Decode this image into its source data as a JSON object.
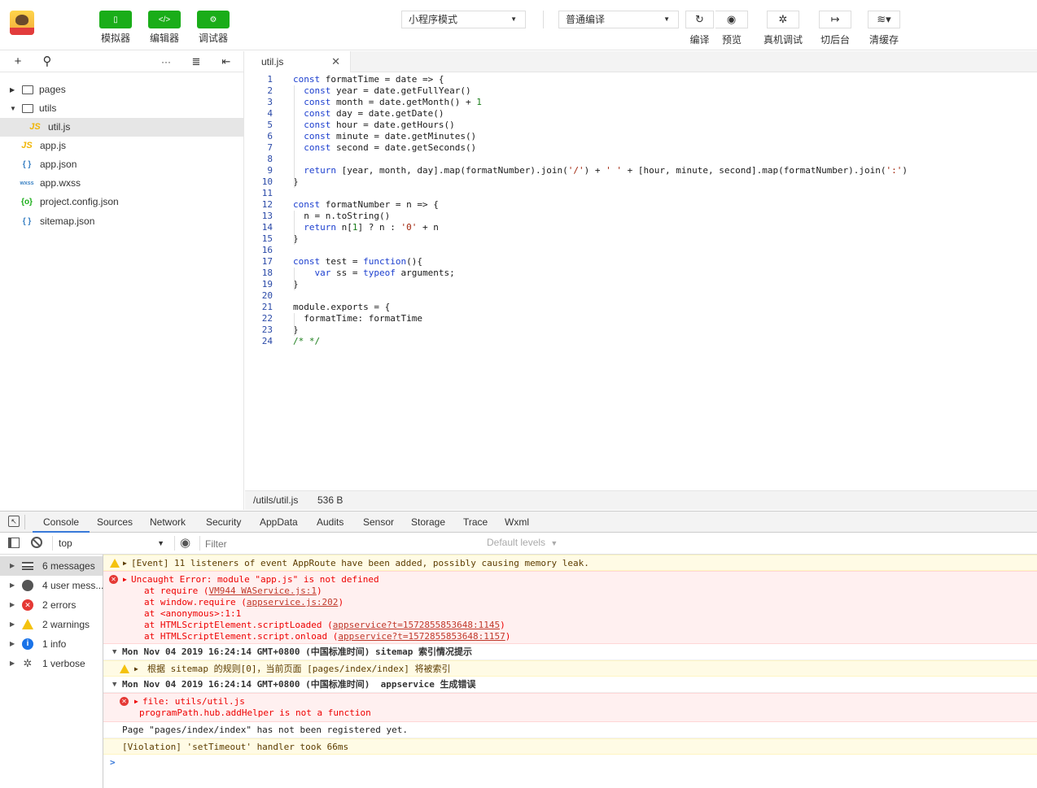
{
  "toolbar": {
    "buttons": [
      {
        "label": "模拟器",
        "icon": "phone-icon",
        "glyph": "▯"
      },
      {
        "label": "编辑器",
        "icon": "code-icon",
        "glyph": "</>"
      },
      {
        "label": "调试器",
        "icon": "debug-icon",
        "glyph": "⚙"
      }
    ],
    "mode_select": "小程序模式",
    "compile_select": "普通编译",
    "actions": [
      {
        "label": "编译",
        "icon": "refresh-icon",
        "glyph": "↻"
      },
      {
        "label": "预览",
        "icon": "eye-icon",
        "glyph": "◉"
      },
      {
        "label": "真机调试",
        "icon": "bug-icon",
        "glyph": "✲"
      },
      {
        "label": "切后台",
        "icon": "switch-background-icon",
        "glyph": "↦"
      },
      {
        "label": "清缓存",
        "icon": "layers-icon",
        "glyph": "≋▾"
      }
    ]
  },
  "explorer": {
    "tools": [
      {
        "name": "add-icon",
        "glyph": "+"
      },
      {
        "name": "search-icon",
        "glyph": "⚲"
      },
      {
        "name": "more-icon",
        "glyph": "···"
      },
      {
        "name": "sort-icon",
        "glyph": "≣"
      },
      {
        "name": "collapse-icon",
        "glyph": "⇤"
      }
    ],
    "tree": [
      {
        "label": "pages",
        "type": "folder",
        "expanded": false,
        "depth": 0,
        "icon_text": "▭"
      },
      {
        "label": "utils",
        "type": "folder",
        "expanded": true,
        "depth": 0,
        "icon_text": "▭"
      },
      {
        "label": "util.js",
        "type": "js",
        "depth": 1,
        "selected": true,
        "icon_text": "JS",
        "icon_color": "#f0b400"
      },
      {
        "label": "app.js",
        "type": "js",
        "depth": 0,
        "icon_text": "JS",
        "icon_color": "#f0b400"
      },
      {
        "label": "app.json",
        "type": "json",
        "depth": 0,
        "icon_text": "{ }",
        "icon_color": "#3b82c4"
      },
      {
        "label": "app.wxss",
        "type": "wxss",
        "depth": 0,
        "icon_text": "wxss",
        "icon_color": "#3b82c4"
      },
      {
        "label": "project.config.json",
        "type": "config",
        "depth": 0,
        "icon_text": "{o}",
        "icon_color": "#1aad19"
      },
      {
        "label": "sitemap.json",
        "type": "json",
        "depth": 0,
        "icon_text": "{ }",
        "icon_color": "#3b82c4"
      }
    ]
  },
  "editor": {
    "tab": "util.js",
    "lines": [
      "const formatTime = date => {",
      "  const year = date.getFullYear()",
      "  const month = date.getMonth() + 1",
      "  const day = date.getDate()",
      "  const hour = date.getHours()",
      "  const minute = date.getMinutes()",
      "  const second = date.getSeconds()",
      "",
      "  return [year, month, day].map(formatNumber).join('/') + ' ' + [hour, minute, second].map(formatNumber).join(':')",
      "}",
      "",
      "const formatNumber = n => {",
      "  n = n.toString()",
      "  return n[1] ? n : '0' + n",
      "}",
      "",
      "const test = function(){",
      "    var ss = typeof arguments;",
      "}",
      "",
      "module.exports = {",
      "  formatTime: formatTime",
      "}",
      "/* */"
    ],
    "status_path": "/utils/util.js",
    "status_size": "536 B"
  },
  "devtools": {
    "inspect_icon": "inspect-icon",
    "tabs": [
      "Console",
      "Sources",
      "Network",
      "Security",
      "AppData",
      "Audits",
      "Sensor",
      "Storage",
      "Trace",
      "Wxml"
    ],
    "active_tab": "Console",
    "context": "top",
    "filter_placeholder": "Filter",
    "levels": "Default levels",
    "sidebar": [
      {
        "label": "6 messages",
        "icon": "list-icon",
        "active": true
      },
      {
        "label": "4 user mess...",
        "icon": "user-icon"
      },
      {
        "label": "2 errors",
        "icon": "error-icon"
      },
      {
        "label": "2 warnings",
        "icon": "warning-icon"
      },
      {
        "label": "1 info",
        "icon": "info-icon"
      },
      {
        "label": "1 verbose",
        "icon": "verbose-icon"
      }
    ],
    "messages": {
      "m1": "[Event] 11 listeners of event AppRoute have been added, possibly causing memory leak.",
      "m2_head": "Uncaught Error: module \"app.js\" is not defined",
      "m2_stack": [
        {
          "pre": "at require (",
          "link": "VM944 WAService.js:1",
          "post": ")"
        },
        {
          "pre": "at window.require (",
          "link": "appservice.js:202",
          "post": ")"
        },
        {
          "pre": "at <anonymous>:1:1",
          "link": "",
          "post": ""
        },
        {
          "pre": "at HTMLScriptElement.scriptLoaded (",
          "link": "appservice?t=1572855853648:1145",
          "post": ")"
        },
        {
          "pre": "at HTMLScriptElement.script.onload (",
          "link": "appservice?t=1572855853648:1157",
          "post": ")"
        }
      ],
      "g1": "Mon Nov 04 2019 16:24:14 GMT+0800 (中国标准时间) sitemap 索引情况提示",
      "g1_warn": "根据 sitemap 的规则[0]，当前页面 [pages/index/index] 将被索引",
      "g2": "Mon Nov 04 2019 16:24:14 GMT+0800 (中国标准时间)  appservice 生成错误",
      "g2_err1": "file: utils/util.js",
      "g2_err2": "programPath.hub.addHelper is not a function",
      "m3": "Page \"pages/index/index\" has not been registered yet.",
      "m4": "[Violation] 'setTimeout' handler took 66ms",
      "prompt": ">"
    }
  }
}
